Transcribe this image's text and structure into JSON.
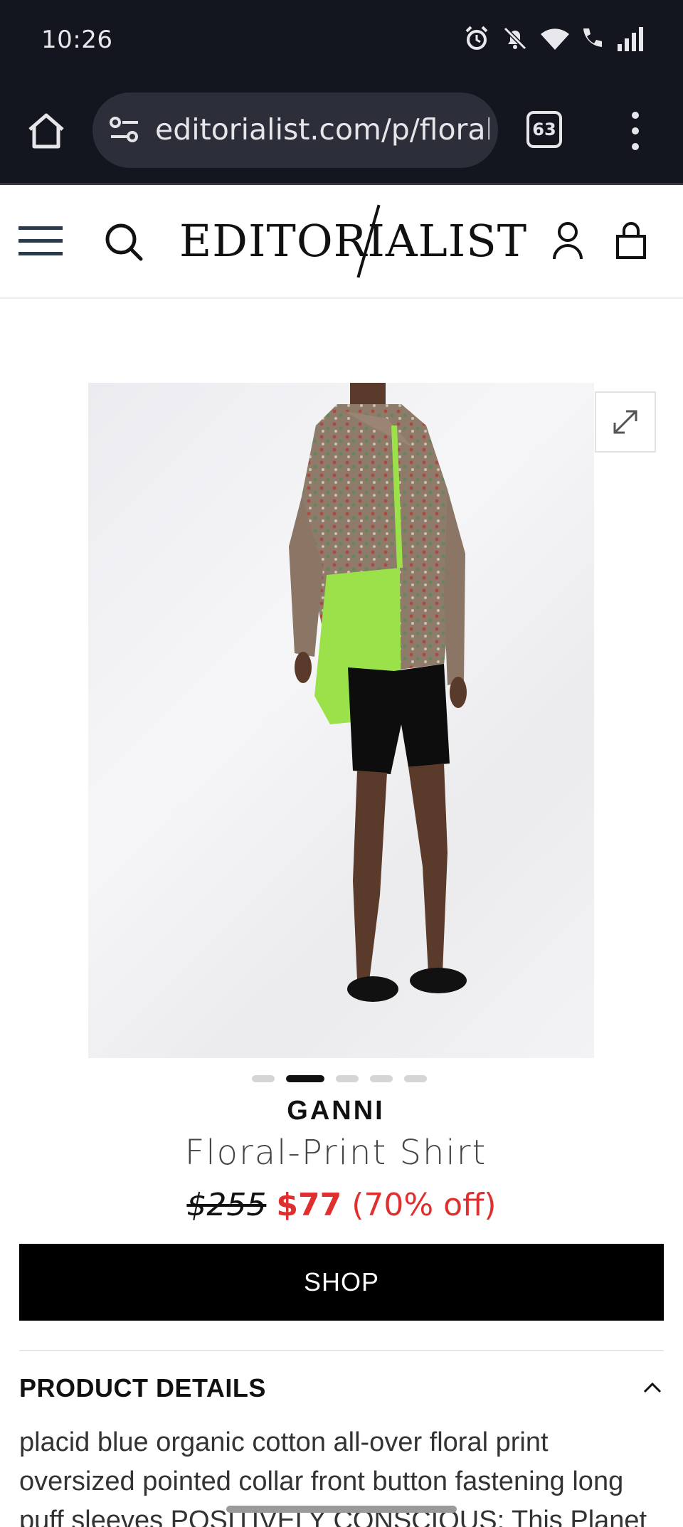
{
  "status_bar": {
    "time": "10:26",
    "icons": [
      "alarm-icon",
      "mute-icon",
      "wifi-icon",
      "wifi-call-icon",
      "signal-icon"
    ]
  },
  "browser": {
    "url": "editorialist.com/p/floral-",
    "tab_count": "63"
  },
  "site": {
    "logo_text": "EDITORIALIST"
  },
  "product": {
    "carousel": {
      "total": 5,
      "active_index": 1
    },
    "brand": "GANNI",
    "name": "Floral-Print Shirt",
    "original_price": "$255",
    "sale_price": "$77",
    "discount": "(70% off)",
    "shop_label": "SHOP"
  },
  "details": {
    "title": "PRODUCT DETAILS",
    "text": "placid blue organic cotton all-over floral print oversized pointed collar front button fastening long puff sleeves POSITIVELY CONSCIOUS: This Planet Conscious product"
  },
  "colors": {
    "chrome_bg": "#14161f",
    "url_bg": "#2c2f3a",
    "sale_red": "#e02f2f",
    "button_black": "#000000"
  }
}
